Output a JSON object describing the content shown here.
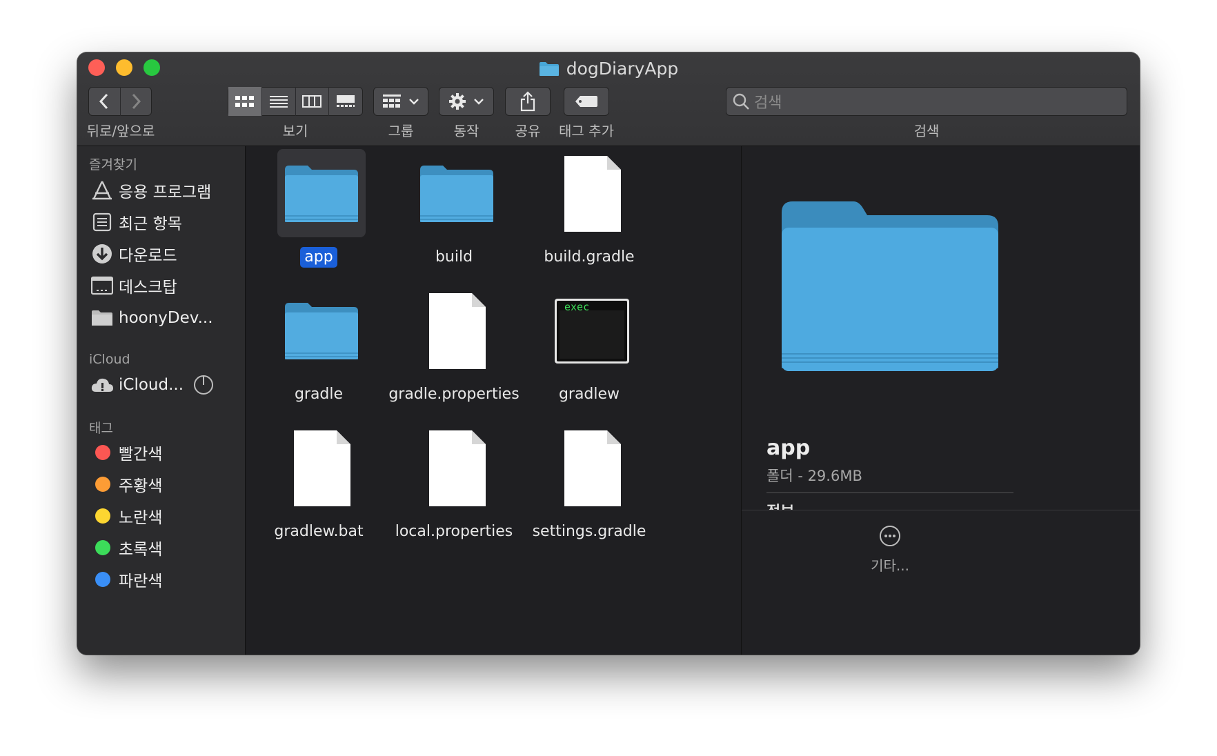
{
  "window": {
    "title": "dogDiaryApp"
  },
  "toolbar": {
    "nav_label": "뒤로/앞으로",
    "view_label": "보기",
    "group_label": "그룹",
    "action_label": "동작",
    "share_label": "공유",
    "tag_label": "태그 추가",
    "search_label": "검색",
    "search_placeholder": "검색"
  },
  "sidebar": {
    "favorites_title": "즐겨찾기",
    "favorites": [
      {
        "label": "응용 프로그램",
        "icon": "applications-icon"
      },
      {
        "label": "최근 항목",
        "icon": "recents-icon"
      },
      {
        "label": "다운로드",
        "icon": "downloads-icon"
      },
      {
        "label": "데스크탑",
        "icon": "desktop-icon"
      },
      {
        "label": "hoonyDev...",
        "icon": "folder-icon"
      }
    ],
    "icloud_title": "iCloud",
    "icloud_items": [
      {
        "label": "iCloud...",
        "icon": "icloud-icon"
      }
    ],
    "tags_title": "태그",
    "tags": [
      {
        "label": "빨간색",
        "color": "#fc5753"
      },
      {
        "label": "주황색",
        "color": "#fd9c35"
      },
      {
        "label": "노란색",
        "color": "#fdd631"
      },
      {
        "label": "초록색",
        "color": "#3cdc5a"
      },
      {
        "label": "파란색",
        "color": "#3a8ff7"
      }
    ]
  },
  "files": [
    {
      "name": "app",
      "type": "folder",
      "selected": true
    },
    {
      "name": "build",
      "type": "folder"
    },
    {
      "name": "build.gradle",
      "type": "document"
    },
    {
      "name": "gradle",
      "type": "folder"
    },
    {
      "name": "gradle.properties",
      "type": "document"
    },
    {
      "name": "gradlew",
      "type": "exec"
    },
    {
      "name": "gradlew.bat",
      "type": "document"
    },
    {
      "name": "local.properties",
      "type": "document"
    },
    {
      "name": "settings.gradle",
      "type": "document"
    }
  ],
  "exec_badge": "exec",
  "preview": {
    "name": "app",
    "meta": "폴더 - 29.6MB",
    "info_heading": "정보",
    "more_label": "기타..."
  },
  "colors": {
    "folder": "#48a7d8",
    "selection": "#1a5fd9",
    "window_bg": "#1f1f22"
  }
}
